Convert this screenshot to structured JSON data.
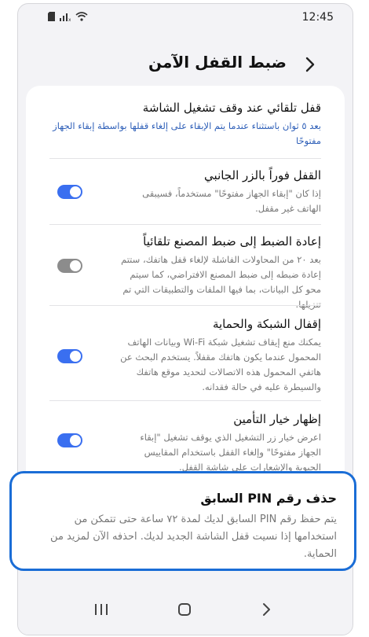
{
  "status_bar": {
    "time": "12:45",
    "icons": [
      "sd-card-icon",
      "signal-icon",
      "wifi-icon"
    ]
  },
  "header": {
    "title": "ضبط القفل الآمن",
    "back_icon": "chevron-right-icon"
  },
  "settings": [
    {
      "id": "auto-lock",
      "title": "قفل تلقائي عند وقف تشغيل الشاشة",
      "description": "بعد ٥ ثوان باستثناء عندما يتم الإبقاء على إلغاء قفلها بواسطة إبقاء الجهاز مفتوحًا"
    },
    {
      "id": "lock-side-key",
      "title": "القفل فوراً بالزر الجانبي",
      "description": "إذا كان \"إبقاء الجهاز مفتوحًا\" مستخدماً، فسيبقى الهاتف غير مقفل.",
      "toggle": "on"
    },
    {
      "id": "auto-factory-reset",
      "title": "إعادة الضبط إلى ضبط المصنع تلقائياً",
      "description": "بعد ٢٠ من المحاولات الفاشلة لإلغاء قفل هاتفك، ستتم إعادة ضبطه إلى ضبط المصنع الافتراضي، كما سيتم محو كل البيانات، بما فيها الملفات والتطبيقات التي تم تنزيلها.",
      "toggle": "off"
    },
    {
      "id": "lock-network-security",
      "title": "إقفال الشبكة والحماية",
      "description": "يمكنك منع إيقاف تشغيل شبكة Wi-Fi وبيانات الهاتف المحمول عندما يكون هاتفك مقفلاً. يستخدم البحث عن هاتفي المحمول هذه الاتصالات لتحديد موقع هاتفك والسيطرة عليه في حالة فقدانه.",
      "toggle": "on"
    },
    {
      "id": "show-lockdown",
      "title": "إظهار خيار التأمين",
      "description": "اعرض خيار زر التشغيل الذي يوقف تشغيل \"إبقاء الجهاز مفتوحًا\" وإلغاء القفل باستخدام المقاييس الحيوية والإشعارات على شاشة القفل.",
      "toggle": "on"
    }
  ],
  "highlight": {
    "title": "حذف رقم PIN السابق",
    "description": "يتم حفظ رقم PIN السابق لديك لمدة ٧٢ ساعة حتى تتمكن من استخدامها إذا نسيت قفل الشاشة الجديد لديك. احذفه الآن لمزيد من الحماية."
  },
  "nav_bar": [
    "recent-apps-icon",
    "home-icon",
    "back-icon"
  ],
  "colors": {
    "accent": "#1a6dd6",
    "toggle_on": "#3a6ff0",
    "toggle_off": "#8c8c8c",
    "link_text": "#2e5fb8"
  }
}
